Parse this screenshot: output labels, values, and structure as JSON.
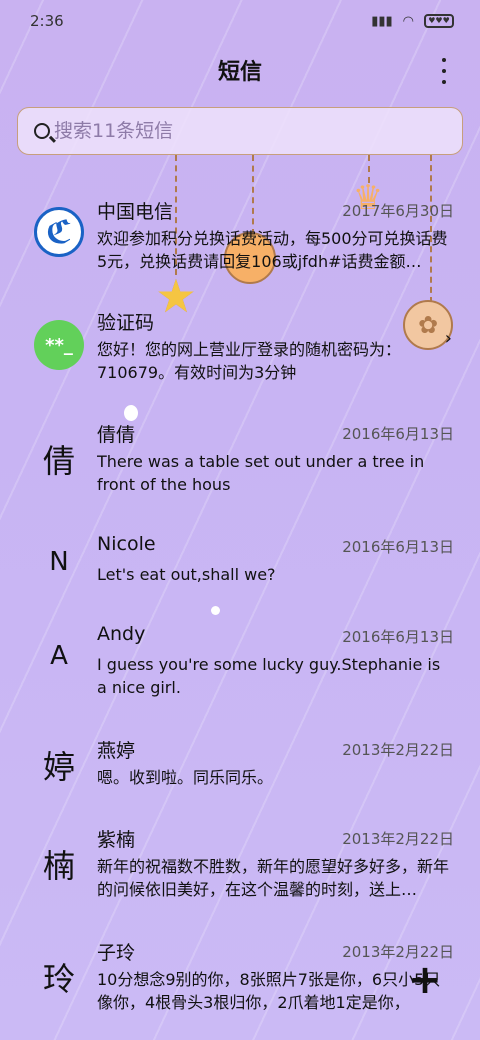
{
  "status": {
    "time": "2:36",
    "battery_glyphs": "♥♥♥"
  },
  "header": {
    "title": "短信"
  },
  "search": {
    "placeholder": "搜索11条短信"
  },
  "colors": {
    "background": "#c9b2f1",
    "search_border": "#c79f7c",
    "telecom_blue": "#1a62c5",
    "verify_green": "#62d05a"
  },
  "conversations": [
    {
      "name": "中国电信",
      "date": "2017年6月30日",
      "preview": "欢迎参加积分兑换话费活动，每500分可兑换话费5元，兑换话费请回复106或jfdh#话费金额…",
      "avatar": {
        "type": "telecom-logo"
      }
    },
    {
      "name": "验证码",
      "date": "",
      "preview": "您好！您的网上营业厅登录的随机密码为：710679。有效时间为3分钟",
      "avatar": {
        "type": "verify",
        "text": "**_"
      }
    },
    {
      "name": "倩倩",
      "date": "2016年6月13日",
      "preview": "There was a table set out under a tree in front of the hous",
      "avatar": {
        "type": "char",
        "text": "倩"
      }
    },
    {
      "name": "Nicole",
      "date": "2016年6月13日",
      "preview": "Let's eat out,shall we?",
      "avatar": {
        "type": "char",
        "text": "N"
      }
    },
    {
      "name": "Andy",
      "date": "2016年6月13日",
      "preview": "I guess you're some lucky guy.Stephanie is a nice girl.",
      "avatar": {
        "type": "char",
        "text": "A"
      }
    },
    {
      "name": "燕婷",
      "date": "2013年2月22日",
      "preview": "嗯。收到啦。同乐同乐。",
      "avatar": {
        "type": "char",
        "text": "婷"
      }
    },
    {
      "name": "紫楠",
      "date": "2013年2月22日",
      "preview": "新年的祝福数不胜数，新年的愿望好多好多，新年的问候依旧美好，在这个温馨的时刻，送上…",
      "avatar": {
        "type": "char",
        "text": "楠"
      }
    },
    {
      "name": "子玲",
      "date": "2013年2月22日",
      "preview": "10分想念9别的你，8张照片7张是你，6只小5只像你，4根骨头3根归你，2爪着地1定是你，",
      "avatar": {
        "type": "char",
        "text": "玲"
      }
    }
  ],
  "fab": {
    "label": "+"
  },
  "chevron": "›"
}
